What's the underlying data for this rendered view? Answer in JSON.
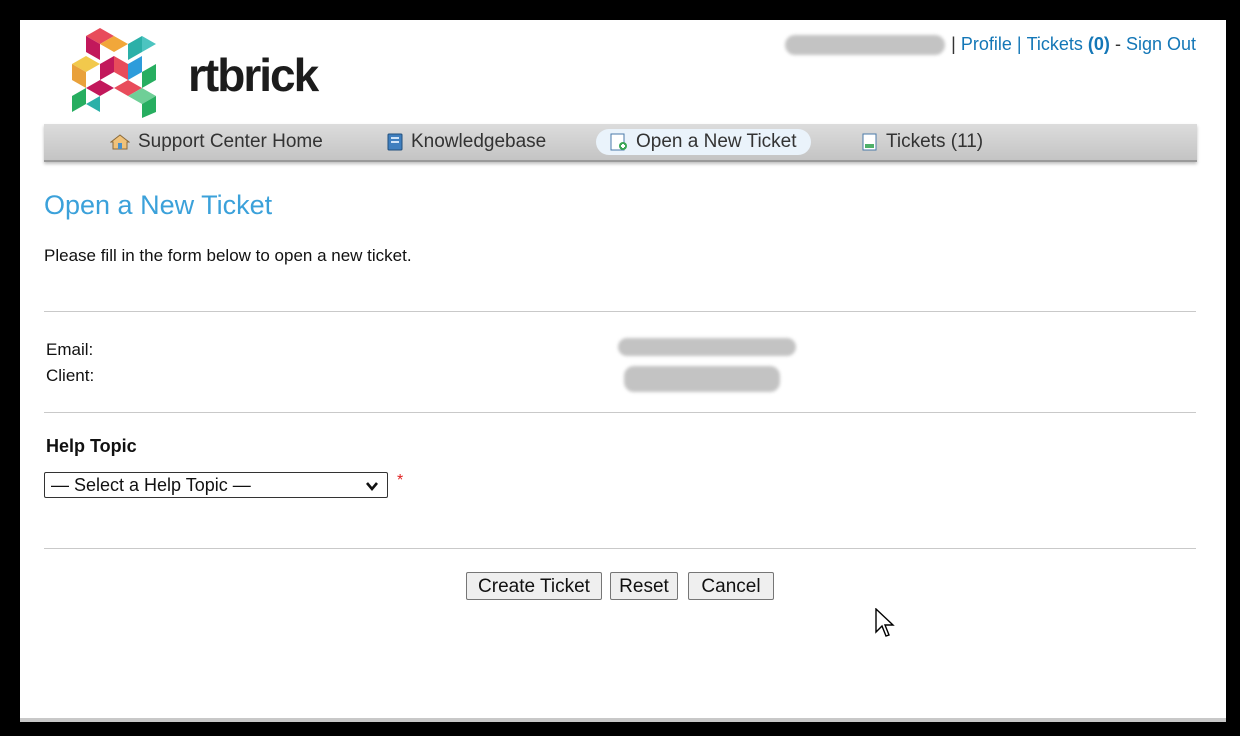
{
  "brand": {
    "name": "rtbrick"
  },
  "header": {
    "sep1": "|",
    "profile": "Profile",
    "sep2": "|",
    "tickets_label": "Tickets",
    "tickets_count": "(0)",
    "sep3": "-",
    "sign_out": "Sign Out"
  },
  "nav": {
    "items": [
      {
        "label": "Support Center Home",
        "icon": "home-icon"
      },
      {
        "label": "Knowledgebase",
        "icon": "book-icon"
      },
      {
        "label": "Open a New Ticket",
        "icon": "new-ticket-icon",
        "active": true
      },
      {
        "label": "Tickets (11)",
        "icon": "ticket-icon"
      }
    ]
  },
  "main": {
    "title": "Open a New Ticket",
    "intro": "Please fill in the form below to open a new ticket.",
    "email_label": "Email:",
    "client_label": "Client:",
    "help_topic_heading": "Help Topic",
    "help_topic_select": "— Select a Help Topic —",
    "required_marker": "*"
  },
  "actions": {
    "create": "Create Ticket",
    "reset": "Reset",
    "cancel": "Cancel"
  },
  "colors": {
    "link": "#1477b7",
    "title": "#3ba1da",
    "required": "#e02020",
    "active_tab": "#eaf3fb"
  }
}
